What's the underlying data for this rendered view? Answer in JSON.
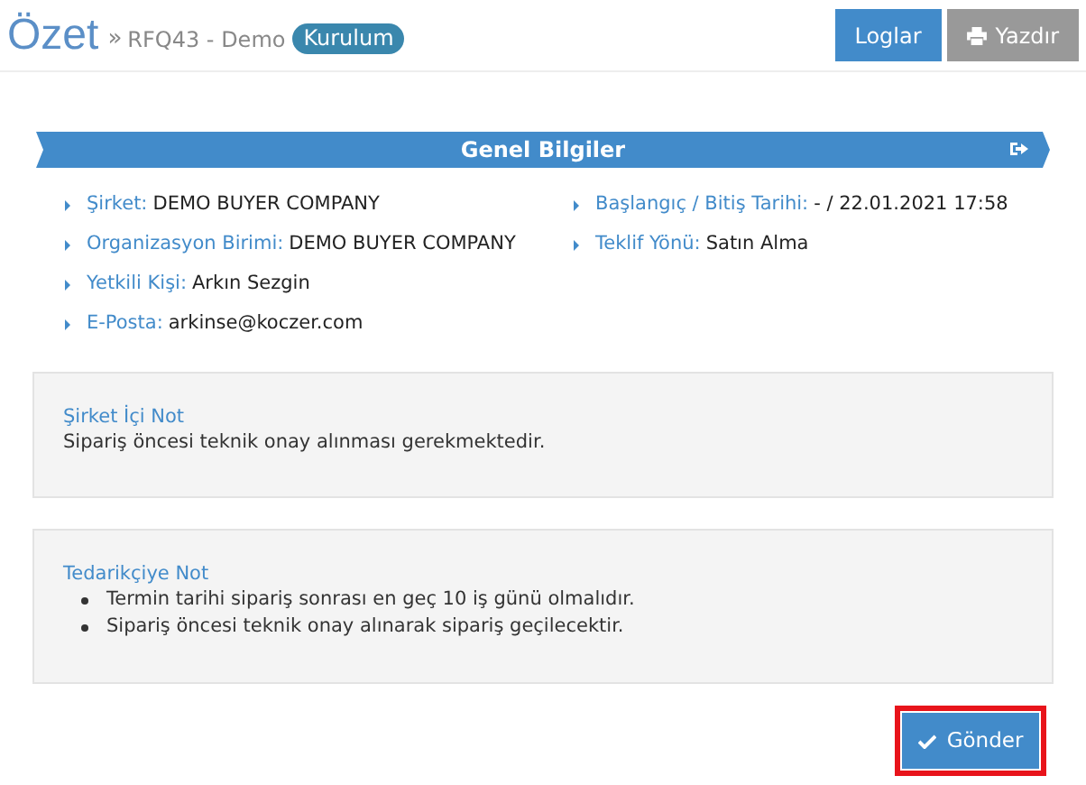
{
  "header": {
    "title": "Özet",
    "separator": "»",
    "subtitle": "RFQ43 - Demo",
    "badge": "Kurulum",
    "buttons": [
      {
        "label": "Loglar",
        "kind": "primary"
      },
      {
        "label": "Yazdır",
        "kind": "print"
      }
    ]
  },
  "section": {
    "title": "Genel Bilgiler"
  },
  "info_columns": [
    [
      {
        "label": "Şirket:",
        "value": "DEMO BUYER COMPANY"
      },
      {
        "label": "Organizasyon Birimi:",
        "value": "DEMO BUYER COMPANY"
      },
      {
        "label": "Yetkili Kişi:",
        "value": "Arkın Sezgin"
      },
      {
        "label": "E-Posta:",
        "value": "arkinse@koczer.com"
      }
    ],
    [
      {
        "label": "Başlangıç / Bitiş Tarihi:",
        "value": "- / 22.01.2021 17:58"
      },
      {
        "label": "Teklif Yönü:",
        "value": "Satın Alma"
      }
    ]
  ],
  "notes": [
    {
      "title": "Şirket İçi Not",
      "kind": "text",
      "text": "Sipariş öncesi teknik onay alınması gerekmektedir."
    },
    {
      "title": "Tedarikçiye Not",
      "kind": "list",
      "items": [
        "Termin tarihi sipariş sonrası en geç 10 iş günü olmalıdır.",
        "Sipariş öncesi teknik onay alınarak sipariş geçilecektir."
      ]
    }
  ],
  "submit": {
    "label": "Gönder",
    "highlighted": true
  }
}
